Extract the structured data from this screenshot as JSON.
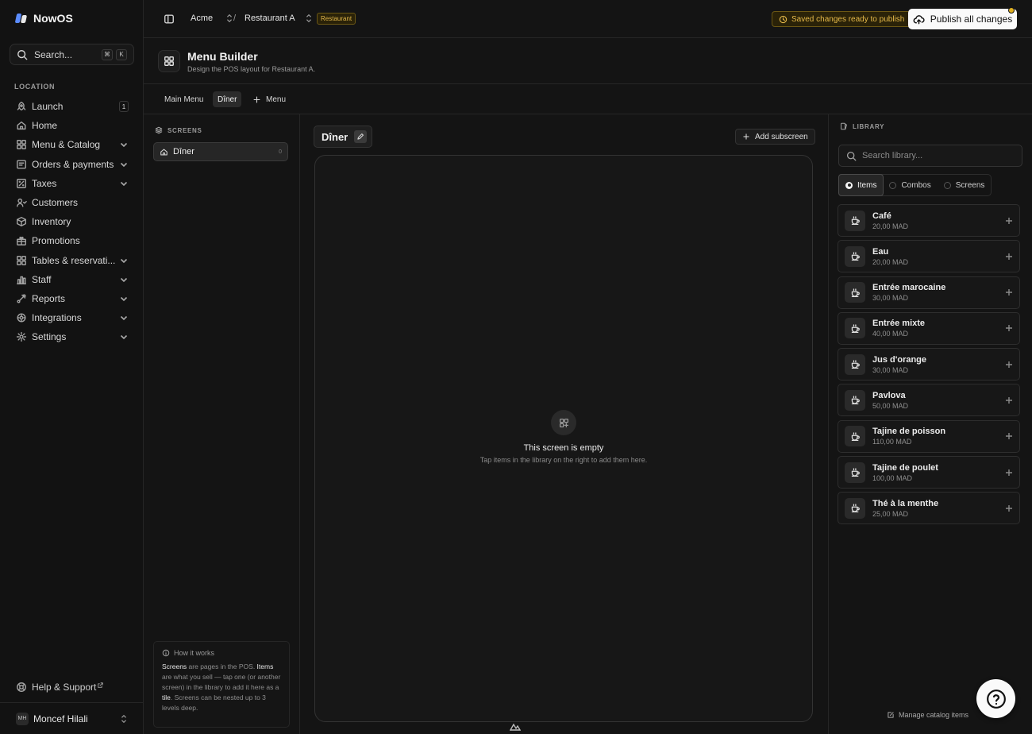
{
  "app": {
    "name": "NowOS"
  },
  "sidebar": {
    "search_label": "Search...",
    "shortcut": [
      "⌘",
      "K"
    ],
    "section_label": "LOCATION",
    "items": [
      {
        "label": "Launch",
        "icon": "rocket-icon",
        "badge": "1"
      },
      {
        "label": "Home",
        "icon": "home-icon"
      },
      {
        "label": "Menu & Catalog",
        "icon": "grid-icon",
        "expandable": true
      },
      {
        "label": "Orders & payments",
        "icon": "card-icon",
        "expandable": true
      },
      {
        "label": "Taxes",
        "icon": "percent-icon",
        "expandable": true
      },
      {
        "label": "Customers",
        "icon": "users-icon"
      },
      {
        "label": "Inventory",
        "icon": "box-icon"
      },
      {
        "label": "Promotions",
        "icon": "gift-icon"
      },
      {
        "label": "Tables & reservati...",
        "icon": "table-icon",
        "expandable": true
      },
      {
        "label": "Staff",
        "icon": "staff-icon",
        "expandable": true
      },
      {
        "label": "Reports",
        "icon": "chart-icon",
        "expandable": true
      },
      {
        "label": "Integrations",
        "icon": "plug-icon",
        "expandable": true
      },
      {
        "label": "Settings",
        "icon": "gear-icon",
        "expandable": true
      }
    ],
    "help_label": "Help & Support",
    "user": {
      "initials": "MH",
      "name": "Moncef Hilali"
    }
  },
  "topbar": {
    "org": "Acme",
    "separator": "/",
    "location": "Restaurant A",
    "location_tag": "Restaurant",
    "saved_status": "Saved changes ready to publish",
    "publish_label": "Publish all changes"
  },
  "page": {
    "title": "Menu Builder",
    "subtitle": "Design the POS layout for Restaurant A."
  },
  "menu_tabs": [
    {
      "label": "Main Menu",
      "active": false
    },
    {
      "label": "Dîner",
      "active": true
    }
  ],
  "add_menu_label": "Menu",
  "screens": {
    "label": "SCREENS",
    "items": [
      {
        "label": "Dîner",
        "count": "0"
      }
    ],
    "how": {
      "title": "How it works",
      "parts": {
        "w1": "Screens",
        "t1": " are pages in the POS. ",
        "w2": "Items",
        "t2": " are what you sell — tap one (or another screen) in the library to add it here as a ",
        "w3": "tile",
        "t3": ". Screens can be nested up to 3 levels deep."
      }
    }
  },
  "canvas": {
    "screen_title": "Dîner",
    "add_subscreen_label": "Add subscreen",
    "empty_title": "This screen is empty",
    "empty_subtitle": "Tap items in the library on the right to add them here."
  },
  "library": {
    "label": "LIBRARY",
    "search_placeholder": "Search library...",
    "tabs": [
      {
        "label": "Items",
        "active": true
      },
      {
        "label": "Combos",
        "active": false
      },
      {
        "label": "Screens",
        "active": false
      }
    ],
    "items": [
      {
        "name": "Café",
        "price": "20,00 MAD"
      },
      {
        "name": "Eau",
        "price": "20,00 MAD"
      },
      {
        "name": "Entrée marocaine",
        "price": "30,00 MAD"
      },
      {
        "name": "Entrée mixte",
        "price": "40,00 MAD"
      },
      {
        "name": "Jus d'orange",
        "price": "30,00 MAD"
      },
      {
        "name": "Pavlova",
        "price": "50,00 MAD"
      },
      {
        "name": "Tajine de poisson",
        "price": "110,00 MAD"
      },
      {
        "name": "Tajine de poulet",
        "price": "100,00 MAD"
      },
      {
        "name": "Thé à la menthe",
        "price": "25,00 MAD"
      }
    ],
    "manage_label": "Manage catalog items"
  },
  "colors": {
    "accent_gold": "#e0b64a",
    "background": "#141414",
    "publish_bg": "#fafafa"
  }
}
